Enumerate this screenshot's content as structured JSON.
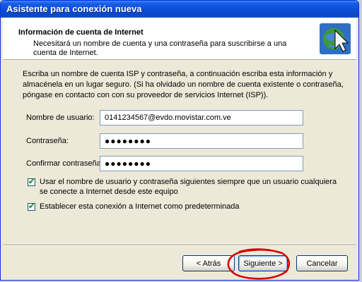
{
  "window": {
    "title": "Asistente para conexión nueva"
  },
  "header": {
    "title": "Información de cuenta de Internet",
    "description": "Necesitará un nombre de cuenta y una contraseña para suscribirse a una cuenta de Internet.",
    "icon": "connection-wizard-icon"
  },
  "instructions": "Escriba un nombre de cuenta ISP y contraseña, a continuación escriba esta información y almacénela en un lugar seguro. (Si ha olvidado un nombre de cuenta existente o contraseña, póngase en contacto con con su proveedor de servicios Internet (ISP)).",
  "form": {
    "username_label": "Nombre de usuario:",
    "username_value": "0141234567@evdo.movistar.com.ve",
    "password_label": "Contraseña:",
    "password_value": "●●●●●●●●",
    "confirm_label": "Confirmar contraseña:",
    "confirm_value": "●●●●●●●●"
  },
  "checkboxes": [
    {
      "label": "Usar el nombre de usuario y contraseña siguientes siempre que un usuario cualquiera se conecte a Internet desde este equipo",
      "checked": true
    },
    {
      "label": "Establecer esta conexión a Internet como predeterminada",
      "checked": true
    }
  ],
  "buttons": {
    "back": "< Atrás",
    "next": "Siguiente >",
    "cancel": "Cancelar"
  },
  "colors": {
    "titlebar": "#0a4fd8",
    "highlight_circle": "#d40000"
  }
}
